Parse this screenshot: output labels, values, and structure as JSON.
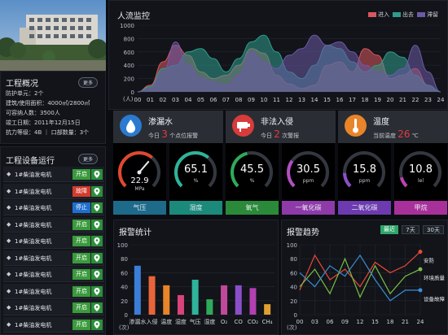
{
  "overview": {
    "title": "工程概况",
    "more_label": "更多",
    "lines": [
      "防护单元：2个",
      "建筑/使用面积：4000㎡/2800㎡",
      "可容纳人数：3500人",
      "竣工日期：2011年12月15日",
      "抗力等级：4B ｜ 口部数量：3个"
    ]
  },
  "equipment": {
    "title": "工程设备运行",
    "more_label": "更多",
    "rows": [
      {
        "name": "1#柴油发电机",
        "status": "开启",
        "color": "#3a9a3c"
      },
      {
        "name": "1#柴油发电机",
        "status": "故障",
        "color": "#d23b2d"
      },
      {
        "name": "1#柴油发电机",
        "status": "停止",
        "color": "#1f6fd0"
      },
      {
        "name": "1#柴油发电机",
        "status": "开启",
        "color": "#3a9a3c"
      },
      {
        "name": "1#柴油发电机",
        "status": "开启",
        "color": "#3a9a3c"
      },
      {
        "name": "1#柴油发电机",
        "status": "开启",
        "color": "#3a9a3c"
      },
      {
        "name": "1#柴油发电机",
        "status": "开启",
        "color": "#3a9a3c"
      },
      {
        "name": "1#柴油发电机",
        "status": "开启",
        "color": "#3a9a3c"
      },
      {
        "name": "1#柴油发电机",
        "status": "开启",
        "color": "#3a9a3c"
      },
      {
        "name": "1#柴油发电机",
        "status": "开启",
        "color": "#3a9a3c"
      }
    ]
  },
  "sensors": [
    {
      "title": "渗漏水",
      "prefix": "今日",
      "value": "3",
      "suffix": "个点位报警",
      "icon": "water-drop-icon",
      "color": "#2a7ad0"
    },
    {
      "title": "非法入侵",
      "prefix": "今日",
      "value": "2",
      "suffix": "次警报",
      "icon": "camera-icon",
      "color": "#d83b3b"
    },
    {
      "title": "温度",
      "prefix": "当前温度",
      "value": "26",
      "suffix": "℃",
      "icon": "thermometer-icon",
      "color": "#e8842a"
    }
  ],
  "gauges": [
    {
      "label": "气压",
      "value": "22.9",
      "unit": "MPa",
      "level": 0.65,
      "color": "#e04830",
      "labelbg": "#1e6a8a"
    },
    {
      "label": "湿度",
      "value": "65.1",
      "unit": "%",
      "level": 0.65,
      "color": "#2fb39a",
      "labelbg": "#1b8a7a"
    },
    {
      "label": "氧气",
      "value": "45.5",
      "unit": "%",
      "level": 0.45,
      "color": "#2faa5a",
      "labelbg": "#2b8a3a"
    },
    {
      "label": "一氧化碳",
      "value": "30.5",
      "unit": "ppm",
      "level": 0.3,
      "color": "#b34fc2",
      "labelbg": "#8e3aa8"
    },
    {
      "label": "二氧化碳",
      "value": "15.8",
      "unit": "ppm",
      "level": 0.16,
      "color": "#8a4fc8",
      "labelbg": "#6d3ab0"
    },
    {
      "label": "甲烷",
      "value": "10.8",
      "unit": "lel",
      "level": 0.11,
      "color": "#c040b0",
      "labelbg": "#a8309a"
    }
  ],
  "chart_data": [
    {
      "type": "area",
      "title": "人流监控",
      "ylabel": "(人)",
      "ylim": [
        0,
        1000
      ],
      "yticks": [
        "0",
        "200",
        "400",
        "600",
        "800",
        "1000"
      ],
      "x": [
        "00",
        "01",
        "02",
        "03",
        "04",
        "05",
        "06",
        "07",
        "08",
        "09",
        "10",
        "11",
        "12",
        "13",
        "14",
        "15",
        "16",
        "17",
        "18",
        "19",
        "20",
        "21",
        "22",
        "23",
        "24"
      ],
      "legend": "top-right",
      "series": [
        {
          "name": "进入",
          "color": "#d9575f",
          "values": [
            0,
            100,
            450,
            700,
            550,
            300,
            200,
            250,
            400,
            650,
            580,
            250,
            120,
            50,
            100,
            400,
            450,
            300,
            650,
            550,
            200,
            250,
            350,
            100,
            0
          ]
        },
        {
          "name": "出去",
          "color": "#2f9c8e",
          "values": [
            0,
            80,
            350,
            400,
            600,
            650,
            500,
            300,
            500,
            750,
            850,
            600,
            300,
            200,
            400,
            700,
            650,
            450,
            300,
            400,
            600,
            520,
            250,
            100,
            0
          ]
        },
        {
          "name": "滞留",
          "color": "#6c5aa6",
          "values": [
            0,
            50,
            300,
            750,
            400,
            200,
            150,
            100,
            250,
            600,
            450,
            350,
            550,
            650,
            850,
            700,
            750,
            600,
            400,
            300,
            250,
            350,
            700,
            300,
            0
          ]
        }
      ]
    },
    {
      "type": "bar",
      "title": "报警统计",
      "ylabel": "(次)",
      "ylim": [
        0,
        100
      ],
      "yticks": [
        "0",
        "20",
        "40",
        "60",
        "80",
        "100"
      ],
      "categories": [
        "渗漏水",
        "入侵",
        "温度",
        "湿度",
        "气压",
        "湿度",
        "O₂",
        "CO",
        "CO₂",
        "CH₄"
      ],
      "values": [
        70,
        55,
        42,
        28,
        50,
        22,
        42,
        42,
        38,
        15
      ],
      "colors": [
        "#3a7ed8",
        "#e8653a",
        "#e8842a",
        "#d8447a",
        "#2fb39a",
        "#2faa5a",
        "#c0499a",
        "#8a4fc8",
        "#b240b0",
        "#e0a030"
      ]
    },
    {
      "type": "line",
      "title": "报警趋势",
      "ylabel": "(次)",
      "ylim": [
        0,
        100
      ],
      "yticks": [
        "0",
        "20",
        "40",
        "60",
        "80",
        "100"
      ],
      "x": [
        "00",
        "03",
        "06",
        "09",
        "12",
        "15",
        "18",
        "21",
        "24"
      ],
      "series": [
        {
          "name": "安防",
          "color": "#e8483a",
          "values": [
            35,
            85,
            50,
            65,
            40,
            75,
            60,
            70,
            90
          ]
        },
        {
          "name": "环境质量",
          "color": "#7bbf45",
          "values": [
            40,
            65,
            30,
            80,
            25,
            70,
            30,
            55,
            65
          ]
        },
        {
          "name": "设备故障",
          "color": "#3a8ed8",
          "values": [
            60,
            40,
            70,
            55,
            85,
            50,
            20,
            35,
            35
          ]
        }
      ]
    }
  ],
  "trend_tabs": [
    "最近",
    "7天",
    "30天"
  ]
}
